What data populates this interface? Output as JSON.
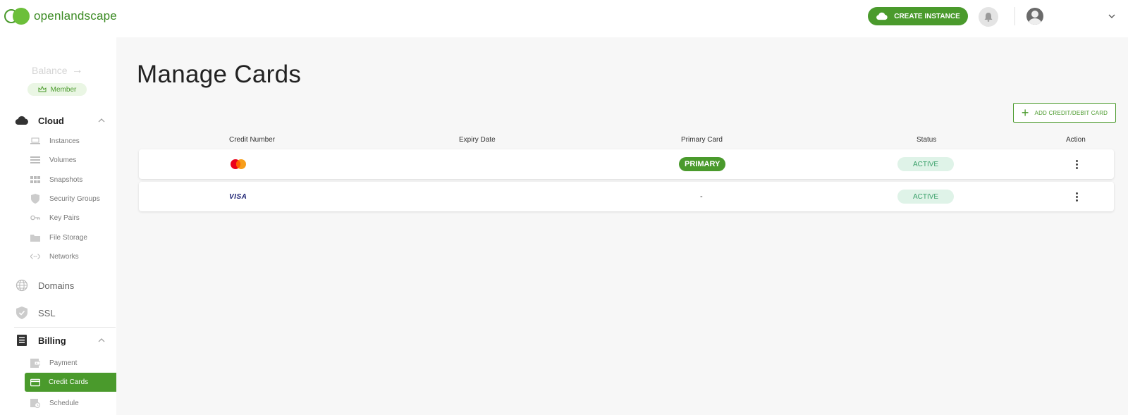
{
  "brand": {
    "logo_text": "openlandscape",
    "accent": "#4a9a2c"
  },
  "sidebar": {
    "balance_label": "Balance",
    "member_label": "Member",
    "sections": {
      "cloud": "Cloud",
      "domains": "Domains",
      "ssl": "SSL",
      "billing": "Billing"
    },
    "cloud_items": [
      "Instances",
      "Volumes",
      "Snapshots",
      "Security Groups",
      "Key Pairs",
      "File Storage",
      "Networks"
    ],
    "billing_items": [
      "Payment",
      "Credit Cards",
      "Schedule"
    ],
    "active_item": "Credit Cards"
  },
  "header": {
    "create_button": "CREATE INSTANCE"
  },
  "main": {
    "title": "Manage Cards",
    "add_button": "ADD CREDIT/DEBIT CARD",
    "columns": [
      "Credit Number",
      "Expiry Date",
      "Primary Card",
      "Status",
      "Action"
    ],
    "rows": [
      {
        "brand": "mastercard",
        "expiry": "",
        "primary": "PRIMARY",
        "status": "ACTIVE"
      },
      {
        "brand": "VISA",
        "expiry": "",
        "primary": "-",
        "status": "ACTIVE"
      }
    ]
  }
}
